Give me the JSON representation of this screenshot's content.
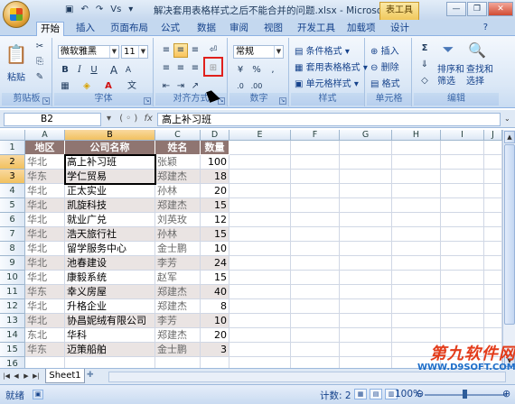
{
  "window": {
    "title": "解决套用表格样式之后不能合并的问题.xlsx - Microsoft Ex...",
    "context_tab": "表工具",
    "qat_undo": "↶",
    "qat_redo": "↷",
    "qat_misc": "Vs"
  },
  "ribbon_tabs": [
    "开始",
    "插入",
    "页面布局",
    "公式",
    "数据",
    "审阅",
    "视图",
    "开发工具",
    "加载项",
    "设计"
  ],
  "ribbon": {
    "clipboard": {
      "paste": "粘贴",
      "label": "剪贴板"
    },
    "font": {
      "name": "微软雅黑",
      "size": "11",
      "bold": "B",
      "italic": "I",
      "underline": "U",
      "grow": "A",
      "shrink": "A",
      "color": "A",
      "label": "字体"
    },
    "alignment": {
      "label": "对齐方式"
    },
    "number": {
      "format": "常规",
      "label": "数字"
    },
    "styles": {
      "conditional": "条件格式",
      "as_table": "套用表格格式",
      "cell_styles": "单元格样式",
      "label": "样式"
    },
    "cells": {
      "insert": "插入",
      "delete": "删除",
      "format": "格式",
      "label": "单元格"
    },
    "editing": {
      "sigma": "Σ",
      "sort_filter": "排序和",
      "sort_filter2": "筛选",
      "find_select": "查找和",
      "find_select2": "选择",
      "label": "编辑"
    }
  },
  "formula_bar": {
    "name_box": "B2",
    "fx_label": "fx",
    "content": "高上补习班"
  },
  "columns": [
    "A",
    "B",
    "C",
    "D",
    "E",
    "F",
    "G",
    "H",
    "I",
    "J"
  ],
  "rows": [
    "1",
    "2",
    "3",
    "4",
    "5",
    "6",
    "7",
    "8",
    "9",
    "10",
    "11",
    "12",
    "13",
    "14",
    "15",
    "16"
  ],
  "table": {
    "headers": [
      "地区",
      "公司名称",
      "姓名",
      "数量"
    ],
    "rows": [
      [
        "华北",
        "高上补习班",
        "张颖",
        "100"
      ],
      [
        "华东",
        "学仁贸易",
        "郑建杰",
        "18"
      ],
      [
        "华北",
        "正太实业",
        "孙林",
        "20"
      ],
      [
        "华北",
        "凯旋科技",
        "郑建杰",
        "15"
      ],
      [
        "华北",
        "就业广兑",
        "刘英玫",
        "12"
      ],
      [
        "华北",
        "浩天旅行社",
        "孙林",
        "15"
      ],
      [
        "华北",
        "留学服务中心",
        "金士鹏",
        "10"
      ],
      [
        "华北",
        "池春建设",
        "李芳",
        "24"
      ],
      [
        "华北",
        "康毅系统",
        "赵军",
        "15"
      ],
      [
        "华东",
        "幸义房屋",
        "郑建杰",
        "40"
      ],
      [
        "华北",
        "升格企业",
        "郑建杰",
        "8"
      ],
      [
        "华北",
        "协昌妮绒有限公司",
        "李芳",
        "10"
      ],
      [
        "东北",
        "华科",
        "郑建杰",
        "20"
      ],
      [
        "华东",
        "迈策船舶",
        "金士鹏",
        "3"
      ]
    ]
  },
  "sheet_tab": "Sheet1",
  "status": {
    "ready": "就绪",
    "count": "计数: 2",
    "zoom": "100%"
  },
  "watermark": {
    "line1": "第九软件网",
    "line2": "WWW.D9SOFT.COM"
  }
}
